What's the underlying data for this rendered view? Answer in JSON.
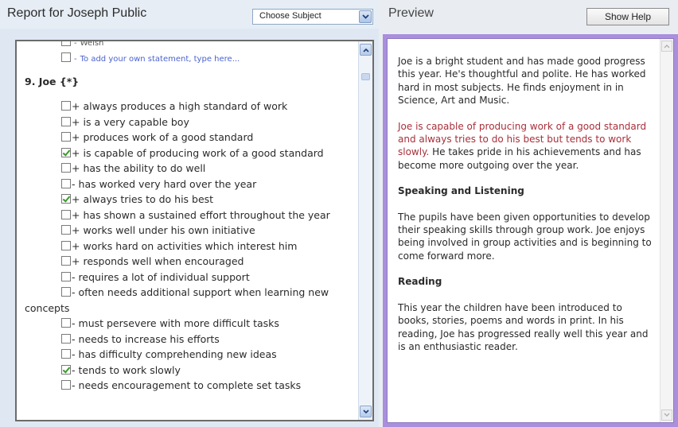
{
  "report": {
    "title": "Report for Joseph Public",
    "subject_select": "Choose Subject"
  },
  "statements": {
    "top_rows": [
      {
        "sign": "-",
        "text": "Welsh",
        "small": false,
        "dim": true
      },
      {
        "sign": "-",
        "text": "To add your own statement, type here...",
        "small": true,
        "dim": false
      }
    ],
    "section_heading": "9. Joe {*}",
    "items": [
      {
        "checked": false,
        "sign": "+",
        "text": "always produces a high standard of work"
      },
      {
        "checked": false,
        "sign": "+",
        "text": "is a very capable boy"
      },
      {
        "checked": false,
        "sign": "+",
        "text": "produces work of a good standard"
      },
      {
        "checked": true,
        "sign": "+",
        "text": "is capable of producing work of a good standard"
      },
      {
        "checked": false,
        "sign": "+",
        "text": "has the ability to do well"
      },
      {
        "checked": false,
        "sign": "-",
        "text": "has worked very hard over the year"
      },
      {
        "checked": true,
        "sign": "+",
        "text": "always tries to do his best"
      },
      {
        "checked": false,
        "sign": "+",
        "text": "has shown a sustained effort throughout the year",
        "wrap": true
      },
      {
        "checked": false,
        "sign": "+",
        "text": "works well under his own initiative"
      },
      {
        "checked": false,
        "sign": "+",
        "text": "works hard on activities which interest him"
      },
      {
        "checked": false,
        "sign": "+",
        "text": "responds well when encouraged"
      },
      {
        "checked": false,
        "sign": "-",
        "text": "requires a lot of individual support"
      },
      {
        "checked": false,
        "sign": "-",
        "text": "often needs additional support when learning new concepts",
        "wrap": true
      },
      {
        "checked": false,
        "sign": "-",
        "text": "must persevere with more difficult tasks"
      },
      {
        "checked": false,
        "sign": "-",
        "text": "needs to increase his efforts"
      },
      {
        "checked": false,
        "sign": "-",
        "text": "has difficulty comprehending new ideas"
      },
      {
        "checked": true,
        "sign": "-",
        "text": "tends to work slowly"
      },
      {
        "checked": false,
        "sign": "-",
        "text": "needs encouragement to complete set tasks"
      }
    ]
  },
  "preview": {
    "title": "Preview",
    "help_button": "Show Help",
    "para1": "Joe is a bright student and has made good progress this year. He's thoughtful and polite. He has worked hard in most subjects. He finds enjoyment in in Science, Art and Music.",
    "para2_red": "Joe is capable of producing work of a good standard and always tries to do his best but tends to work slowly.",
    "para2_rest": " He takes pride in his achievements and has become more outgoing over the year.",
    "heading_speaking": "Speaking and Listening",
    "para_speaking": "The pupils have been given opportunities to develop their speaking skills through group work. Joe enjoys being involved in group activities and is beginning to come forward more.",
    "heading_reading": "Reading",
    "para_reading": "This year the children have been introduced to books, stories, poems and words in print. In his reading, Joe has progressed really well this year and is an enthusiastic reader."
  },
  "colors": {
    "accent_frame": "#a98fdc",
    "highlight_text": "#a8303a",
    "check_mark": "#3a9a2a",
    "own_statement_text": "#4a63cf"
  }
}
